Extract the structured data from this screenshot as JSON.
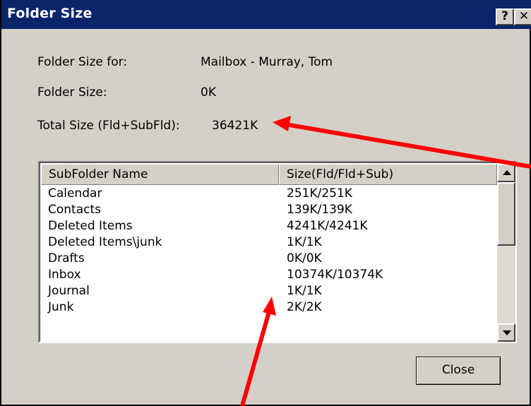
{
  "window": {
    "title": "Folder Size",
    "help_glyph": "?",
    "close_glyph": "✕"
  },
  "summary": {
    "folder_size_for_label": "Folder Size for:",
    "folder_size_for_value": "Mailbox - Murray, Tom",
    "folder_size_label": "Folder Size:",
    "folder_size_value": "0K",
    "total_size_label": "Total Size (Fld+SubFld):",
    "total_size_value": "36421K"
  },
  "list": {
    "headers": [
      "SubFolder Name",
      "Size(Fld/Fld+Sub)"
    ],
    "rows": [
      {
        "name": "Calendar",
        "size": "251K/251K"
      },
      {
        "name": "Contacts",
        "size": "139K/139K"
      },
      {
        "name": "Deleted Items",
        "size": "4241K/4241K"
      },
      {
        "name": "Deleted Items\\junk",
        "size": "1K/1K"
      },
      {
        "name": "Drafts",
        "size": "0K/0K"
      },
      {
        "name": "Inbox",
        "size": "10374K/10374K"
      },
      {
        "name": "Journal",
        "size": "1K/1K"
      },
      {
        "name": "Junk",
        "size": "2K/2K"
      }
    ]
  },
  "buttons": {
    "close_label": "Close"
  },
  "colors": {
    "titlebar": "#0a246a",
    "dialog_bg": "#d4d0c8",
    "annotation_arrow": "#ff0000"
  }
}
